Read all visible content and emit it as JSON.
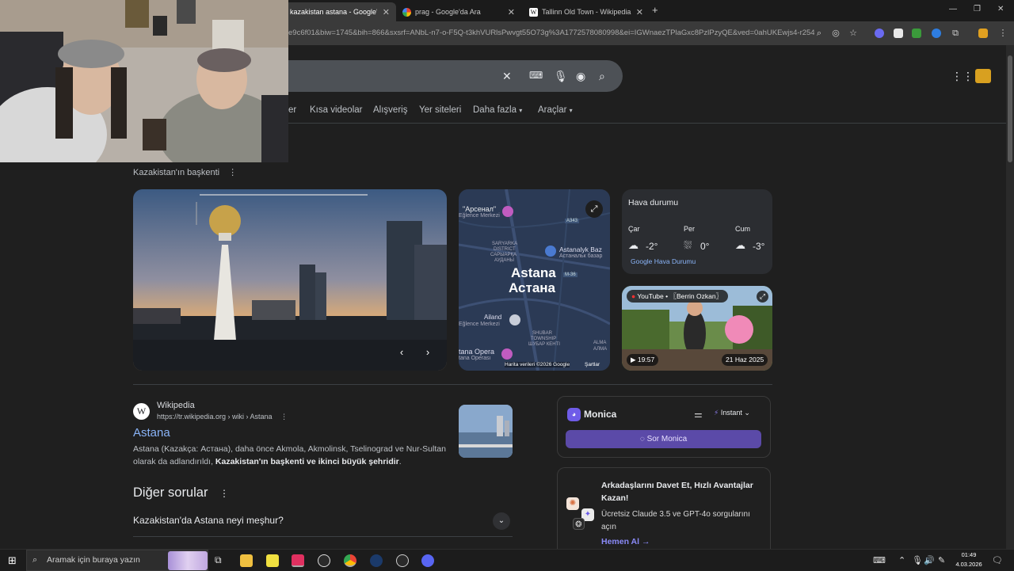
{
  "browser": {
    "tabs": [
      {
        "title": "kazakistan astana - Google'da A",
        "active": true
      },
      {
        "title": "prag - Google'da Ara",
        "active": false
      },
      {
        "title": "Tallinn Old Town - Wikipedia",
        "active": false
      }
    ],
    "new_tab": "+",
    "url": "e9c6f01&biw=1745&bih=866&sxsrf=ANbL-n7-o-F5Q-t3khVURlsPwvgt55O73g%3A1772578080998&ei=IGWnaezTPlaGxc8PzlPzyQE&ved=0ahUKEwjs4-r254S...",
    "window_controls": [
      "—",
      "❐",
      "✕"
    ]
  },
  "search": {
    "clear": "✕",
    "nav_tabs": [
      "er",
      "Kısa videolar",
      "Alışveriş",
      "Yer siteleri",
      "Daha fazla",
      "Araçlar"
    ],
    "kicker": "Kazakistan'ın başkenti"
  },
  "map": {
    "labels": [
      "\"Арсенал\"",
      "Eğlence Merkezi",
      "SARYARKA",
      "DISTRICT",
      "САРЫАРҚА",
      "АУДАНЫ",
      "Astana",
      "Астана",
      "A343",
      "Astanalyk Baz",
      "Астанальк базар",
      "M-36",
      "Ailand",
      "Eğlence Merkezi",
      "SHUBAR",
      "TOWNSHIP",
      "ШУБАР КЕНТІ",
      "ALMA",
      "АЛМА",
      "tana Opera",
      "tana Operası"
    ],
    "credit": "Harita verileri ©2026 Google",
    "terms": "Şartlar"
  },
  "weather": {
    "title": "Hava durumu",
    "days": [
      {
        "day": "Çar",
        "temp": "-2°"
      },
      {
        "day": "Per",
        "temp": "0°"
      },
      {
        "day": "Cum",
        "temp": "-3°"
      }
    ],
    "source": "Google Hava Durumu"
  },
  "video": {
    "source": "YouTube",
    "channel": "〖Berrin Ozkan〗",
    "duration": "19:57",
    "date": "21 Haz 2025"
  },
  "result": {
    "site": "Wikipedia",
    "url": "https://tr.wikipedia.org › wiki › Astana",
    "title": "Astana",
    "snippet_plain": "Astana (Kazakça: Астана), daha önce Akmola, Akmolinsk, Tselinograd ve Nur-Sultan olarak da adlandırıldı, ",
    "snippet_bold": "Kazakistan'ın başkenti ve ikinci büyük şehridir",
    "snippet_end": "."
  },
  "paa": {
    "title": "Diğer sorular",
    "questions": [
      "Kazakistan'da Astana neyi meşhur?"
    ]
  },
  "monica": {
    "name": "Monica",
    "mode": "Instant",
    "button": "Sor Monica"
  },
  "invite": {
    "title": "Arkadaşlarını Davet Et, Hızlı Avantajlar Kazan!",
    "body": "Ücretsiz Claude 3.5 ve GPT-4o sorgularını açın",
    "link": "Hemen Al →"
  },
  "taskbar": {
    "search_placeholder": "Aramak için buraya yazın",
    "time": "01:49",
    "date": "4.03.2026"
  }
}
